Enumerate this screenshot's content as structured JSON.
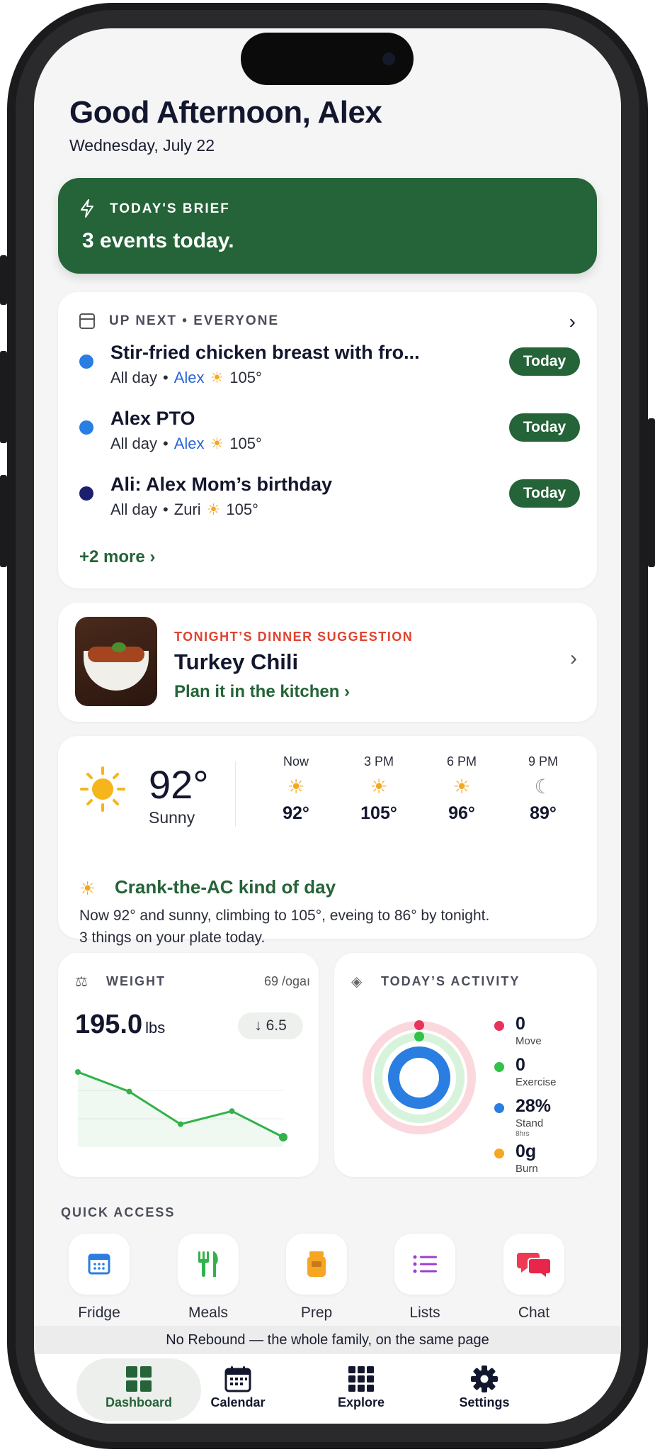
{
  "header": {
    "greeting": "Good Afternoon, Alex",
    "date": "Wednesday, July 22"
  },
  "brief": {
    "label": "TODAY'S BRIEF",
    "text": "3 events today."
  },
  "up_next": {
    "header": "UP NEXT • EVERYONE",
    "events": [
      {
        "title": "Stir-fried chicken breast with fro...",
        "time": "All day",
        "person": "Alex",
        "temp": "105°",
        "badge": "Today",
        "dot_color": "#2a7de1"
      },
      {
        "title": "Alex PTO",
        "time": "All day",
        "person": "Alex",
        "temp": "105°",
        "badge": "Today",
        "dot_color": "#2a7de1"
      },
      {
        "title": "Ali: Alex Mom’s birthday",
        "time": "All day",
        "person": "Zuri",
        "temp": "105°",
        "badge": "Today",
        "dot_color": "#1c1f6b"
      }
    ],
    "more": "+2 more ›"
  },
  "dinner": {
    "tag": "TONIGHT’S DINNER SUGGESTION",
    "name": "Turkey Chili",
    "link": "Plan it in the kitchen ›"
  },
  "weather": {
    "current_temp": "92°",
    "condition": "Sunny",
    "hourly": [
      {
        "label": "Now",
        "temp": "92°",
        "icon": "sun-icon"
      },
      {
        "label": "3 PM",
        "temp": "105°",
        "icon": "sun-icon"
      },
      {
        "label": "6 PM",
        "temp": "96°",
        "icon": "sun-icon"
      },
      {
        "label": "9 PM",
        "temp": "89°",
        "icon": "moon-icon"
      }
    ],
    "summary_title": "Crank-the-AC kind of day",
    "summary_line1": "Now 92° and sunny, climbing to 105°, eveing to 86° by tonight.",
    "summary_line2": "3 things on your plate today."
  },
  "weight": {
    "label": "WEIGHT",
    "goal": "69 /ogaı",
    "value": "195.0",
    "unit": "lbs",
    "delta": "↓ 6.5",
    "trend": [
      5,
      3.5,
      1,
      2,
      0
    ]
  },
  "activity": {
    "label": "TODAY’S ACTIVITY",
    "stats": [
      {
        "value": "0",
        "label": "Move",
        "sub": "",
        "color": "#e8335a"
      },
      {
        "value": "0",
        "label": "Exercise",
        "sub": "",
        "color": "#31c24a"
      },
      {
        "value": "28%",
        "label": "Stand",
        "sub": "8hrs",
        "color": "#2a7de1"
      },
      {
        "value": "0g",
        "label": "Burn",
        "sub": "",
        "color": "#f5a623"
      }
    ],
    "stand_fraction": 0.28
  },
  "quick_access": {
    "label": "QUICK ACCESS",
    "items": [
      {
        "label": "Fridge",
        "icon": "fridge-icon"
      },
      {
        "label": "Meals",
        "icon": "utensils-icon"
      },
      {
        "label": "Prep",
        "icon": "prep-icon"
      },
      {
        "label": "Lists",
        "icon": "list-icon"
      },
      {
        "label": "Chat",
        "icon": "chat-icon"
      }
    ]
  },
  "footer_note": "No Rebound — the whole family, on the same page",
  "tabs": [
    {
      "label": "Dashboard",
      "icon": "grid-icon",
      "active": true
    },
    {
      "label": "Calendar",
      "icon": "calendar-icon",
      "active": false
    },
    {
      "label": "Explore",
      "icon": "explore-icon",
      "active": false
    },
    {
      "label": "Settings",
      "icon": "gear-icon",
      "active": false
    }
  ],
  "colors": {
    "brand_green": "#256338",
    "accent_red": "#e0432f",
    "sun": "#f5a623"
  }
}
